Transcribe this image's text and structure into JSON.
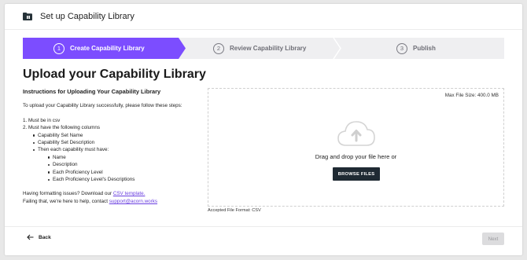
{
  "header": {
    "title": "Set up Capability Library"
  },
  "stepper": {
    "steps": [
      {
        "num": "1",
        "label": "Create Capability Library",
        "state": "active"
      },
      {
        "num": "2",
        "label": "Review Capability Library",
        "state": "inactive"
      },
      {
        "num": "3",
        "label": "Publish",
        "state": "inactive"
      }
    ]
  },
  "page_title": "Upload your Capability Library",
  "instructions": {
    "heading": "Instructions for Uploading Your Capability Library",
    "intro": "To upload your Capability Library successfully, please follow these steps:",
    "items": [
      "1. Must be in csv",
      "2. Must have the following columns"
    ],
    "columns": [
      "Capability Set Name",
      "Capability Set Description",
      "Then each capability must have:"
    ],
    "capability_fields": [
      "Name",
      "Description",
      "Each Proficiency Level",
      "Each Proficiency Level's Descriptions"
    ],
    "help_prefix": "Having formatting issues? Download our ",
    "template_link": "CSV template.",
    "contact_prefix": "Failing that, we're here to help, contact ",
    "support_email": "support@acorn.works"
  },
  "dropzone": {
    "max_size": "Max File Size: 400.0 MB",
    "drag_text": "Drag and drop your file here or",
    "browse_label": "BROWSE FILES",
    "accepted": "Accepted File Format: CSV"
  },
  "footer": {
    "back_label": "Back",
    "next_label": "Next"
  },
  "colors": {
    "accent": "#7c4dff",
    "dark_button": "#1f2a33",
    "link": "#6a3fe0"
  }
}
